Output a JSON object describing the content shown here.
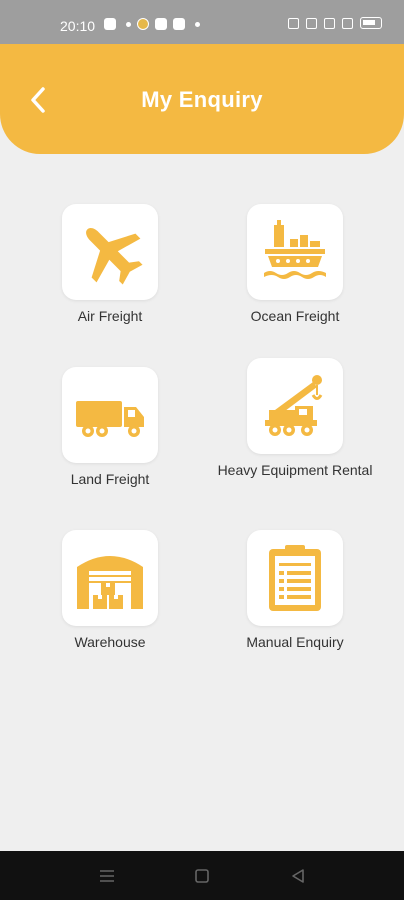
{
  "status_bar": {
    "time": "20:10"
  },
  "header": {
    "title": "My Enquiry"
  },
  "tiles": [
    {
      "label": "Air Freight",
      "icon": "airplane-icon"
    },
    {
      "label": "Ocean Freight",
      "icon": "cargo-ship-icon"
    },
    {
      "label": "Land Freight",
      "icon": "truck-icon"
    },
    {
      "label": "Heavy Equipment Rental",
      "icon": "crane-truck-icon"
    },
    {
      "label": "Warehouse",
      "icon": "warehouse-icon"
    },
    {
      "label": "Manual Enquiry",
      "icon": "clipboard-icon"
    }
  ],
  "colors": {
    "accent": "#f4b942",
    "background": "#efefef",
    "card": "#ffffff",
    "text": "#333333"
  }
}
